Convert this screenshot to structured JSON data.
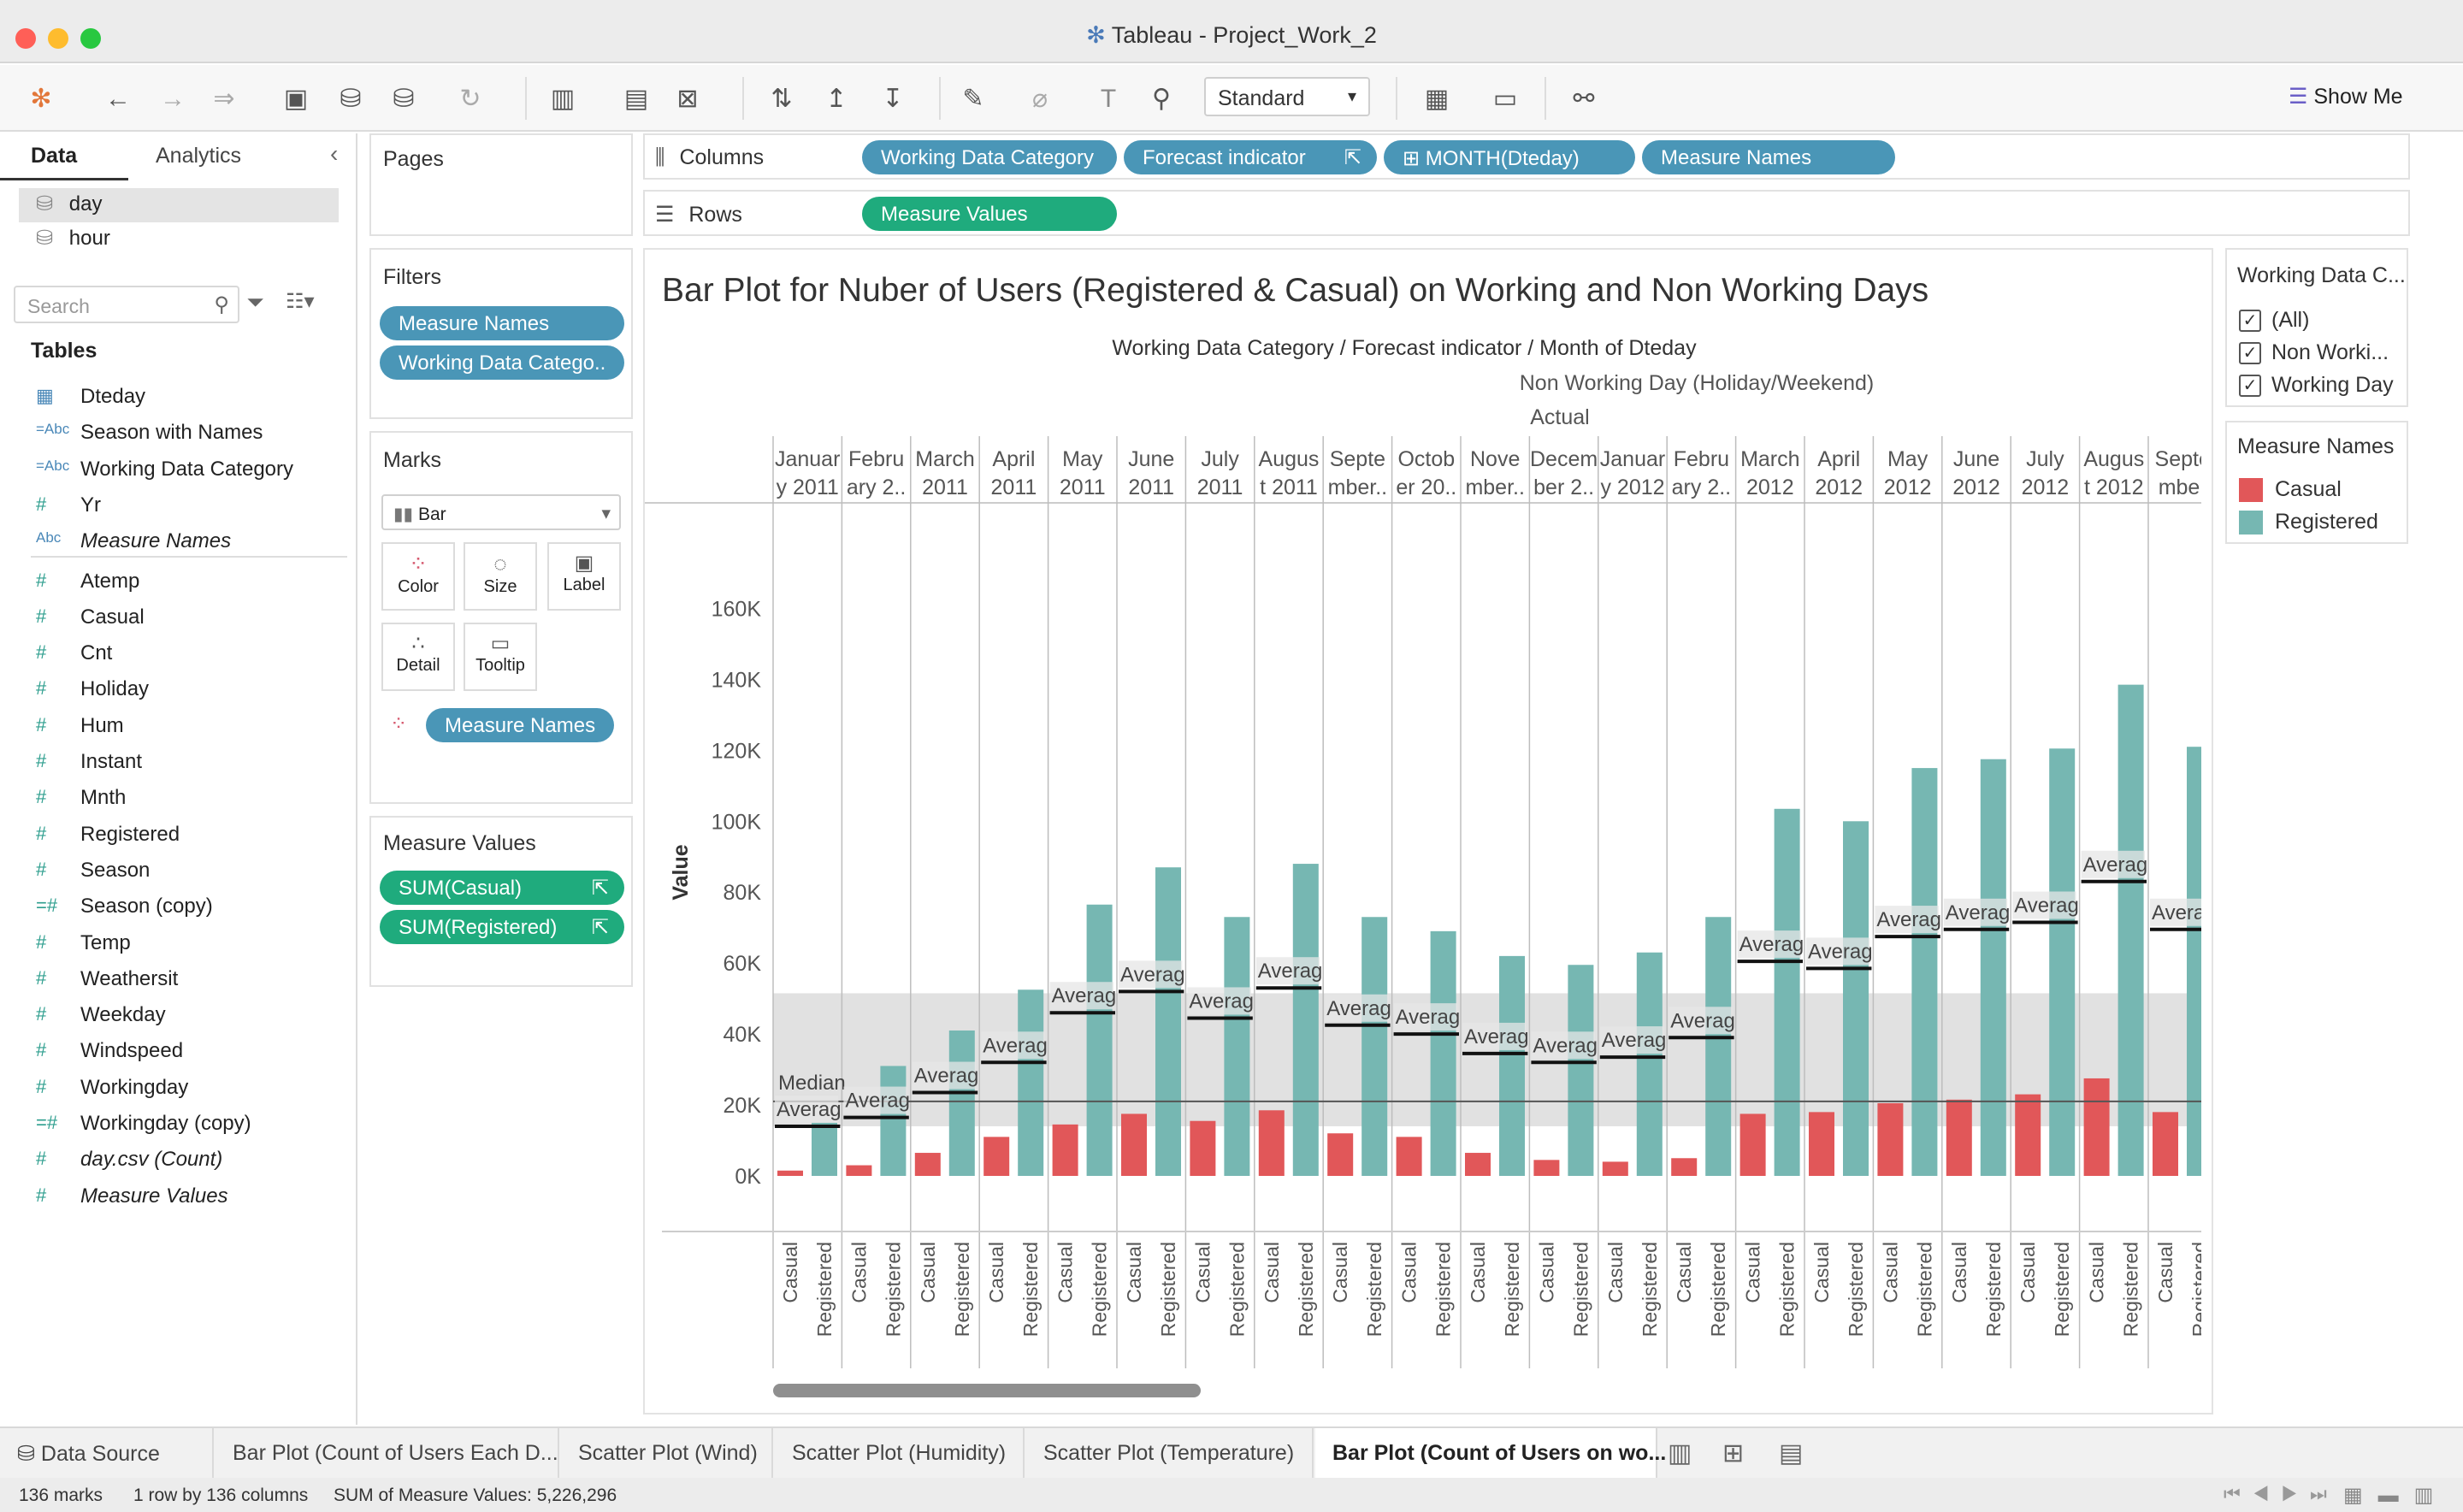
{
  "window": {
    "title": "Tableau - Project_Work_2"
  },
  "toolbar": {
    "fit_select": "Standard",
    "show_me_label": "Show Me"
  },
  "data_pane": {
    "tab_data": "Data",
    "tab_analytics": "Analytics",
    "sources": [
      "day",
      "hour"
    ],
    "search_placeholder": "Search",
    "tables_label": "Tables",
    "fields": [
      {
        "icon": "calendar",
        "name": "Dteday"
      },
      {
        "icon": "=Abc",
        "name": "Season with Names"
      },
      {
        "icon": "=Abc",
        "name": "Working Data Category"
      },
      {
        "icon": "#",
        "name": "Yr"
      },
      {
        "icon": "Abc",
        "name": "Measure Names"
      },
      {
        "icon": "#",
        "name": "Atemp"
      },
      {
        "icon": "#",
        "name": "Casual"
      },
      {
        "icon": "#",
        "name": "Cnt"
      },
      {
        "icon": "#",
        "name": "Holiday"
      },
      {
        "icon": "#",
        "name": "Hum"
      },
      {
        "icon": "#",
        "name": "Instant"
      },
      {
        "icon": "#",
        "name": "Mnth"
      },
      {
        "icon": "#",
        "name": "Registered"
      },
      {
        "icon": "#",
        "name": "Season"
      },
      {
        "icon": "=#",
        "name": "Season (copy)"
      },
      {
        "icon": "#",
        "name": "Temp"
      },
      {
        "icon": "#",
        "name": "Weathersit"
      },
      {
        "icon": "#",
        "name": "Weekday"
      },
      {
        "icon": "#",
        "name": "Windspeed"
      },
      {
        "icon": "#",
        "name": "Workingday"
      },
      {
        "icon": "=#",
        "name": "Workingday (copy)"
      },
      {
        "icon": "#",
        "name": "day.csv (Count)"
      },
      {
        "icon": "#",
        "name": "Measure Values"
      }
    ]
  },
  "shelves": {
    "pages_label": "Pages",
    "filters_label": "Filters",
    "filters": [
      "Measure Names",
      "Working Data Catego.."
    ],
    "marks_label": "Marks",
    "mark_type": "Bar",
    "mark_buttons": [
      "Color",
      "Size",
      "Label",
      "Detail",
      "Tooltip"
    ],
    "marks_pill": "Measure Names",
    "measure_values_label": "Measure Values",
    "measure_values": [
      "SUM(Casual)",
      "SUM(Registered)"
    ],
    "columns_label": "Columns",
    "columns": [
      "Working Data Category",
      "Forecast indicator",
      "MONTH(Dteday)",
      "Measure Names"
    ],
    "rows_label": "Rows",
    "rows": [
      "Measure Values"
    ]
  },
  "legends": {
    "filter_title": "Working Data C...",
    "filter_items": [
      "(All)",
      "Non Worki...",
      "Working Day"
    ],
    "color_title": "Measure Names",
    "color_items": [
      {
        "name": "Casual",
        "color": "#e15759"
      },
      {
        "name": "Registered",
        "color": "#76b7b2"
      }
    ]
  },
  "viz": {
    "title": "Bar Plot for Nuber of Users (Registered & Casual) on Working and Non Working Days",
    "header_path": "Working Data Category  /  Forecast indicator  /  Month of Dteday",
    "header_level1": "Non Working Day (Holiday/Weekend)",
    "header_level2": "Actual",
    "reference_labels": {
      "median": "Median",
      "average": "Averag"
    }
  },
  "chart_data": {
    "type": "bar",
    "title": "Bar Plot for Nuber of Users (Registered & Casual) on Working and Non Working Days",
    "ylabel": "Value",
    "ylim": [
      0,
      170000
    ],
    "yticks": [
      0,
      20000,
      40000,
      60000,
      80000,
      100000,
      120000,
      140000,
      160000
    ],
    "ytick_labels": [
      "0K",
      "20K",
      "40K",
      "60K",
      "80K",
      "100K",
      "120K",
      "140K",
      "160K"
    ],
    "month_labels": [
      [
        "Januar",
        "y 2011"
      ],
      [
        "Febru",
        "ary 2.."
      ],
      [
        "March",
        "2011"
      ],
      [
        "April",
        "2011"
      ],
      [
        "May",
        "2011"
      ],
      [
        "June",
        "2011"
      ],
      [
        "July",
        "2011"
      ],
      [
        "Augus",
        "t 2011"
      ],
      [
        "Septe",
        "mber.."
      ],
      [
        "Octob",
        "er 20.."
      ],
      [
        "Nove",
        "mber.."
      ],
      [
        "Decem",
        "ber 2.."
      ],
      [
        "Januar",
        "y 2012"
      ],
      [
        "Febru",
        "ary 2.."
      ],
      [
        "March",
        "2012"
      ],
      [
        "April",
        "2012"
      ],
      [
        "May",
        "2012"
      ],
      [
        "June",
        "2012"
      ],
      [
        "July",
        "2012"
      ],
      [
        "Augus",
        "t 2012"
      ],
      [
        "Septe",
        "mber"
      ]
    ],
    "series": [
      {
        "name": "Casual",
        "color": "#e15759",
        "values": [
          1500,
          3000,
          6500,
          11000,
          14500,
          17500,
          15500,
          18500,
          12000,
          11000,
          6500,
          4500,
          4000,
          5000,
          17500,
          18000,
          20500,
          21500,
          23000,
          27500,
          18000
        ]
      },
      {
        "name": "Registered",
        "color": "#76b7b2",
        "values": [
          15000,
          31000,
          41000,
          52500,
          76500,
          87000,
          73000,
          88000,
          73000,
          69000,
          62000,
          59500,
          63000,
          73000,
          103500,
          100000,
          115000,
          117500,
          120500,
          138500,
          121000
        ]
      }
    ],
    "averages": [
      14000,
      16500,
      23500,
      32000,
      46000,
      52000,
      44500,
      53000,
      42500,
      40000,
      34500,
      32000,
      33500,
      39000,
      60500,
      58500,
      67500,
      69500,
      71500,
      83000,
      69500
    ],
    "median": 21000,
    "band": [
      14000,
      51500
    ],
    "x_axis_tick_labels": [
      "Casual",
      "Registered"
    ]
  },
  "sheet_tabs": [
    "Data Source",
    "Bar Plot (Count of Users Each D...",
    "Scatter Plot (Wind)",
    "Scatter Plot (Humidity)",
    "Scatter Plot (Temperature)",
    "Bar Plot (Count of Users on wo..."
  ],
  "status": {
    "marks": "136 marks",
    "dims": "1 row by 136 columns",
    "sum": "SUM of Measure Values: 5,226,296"
  }
}
